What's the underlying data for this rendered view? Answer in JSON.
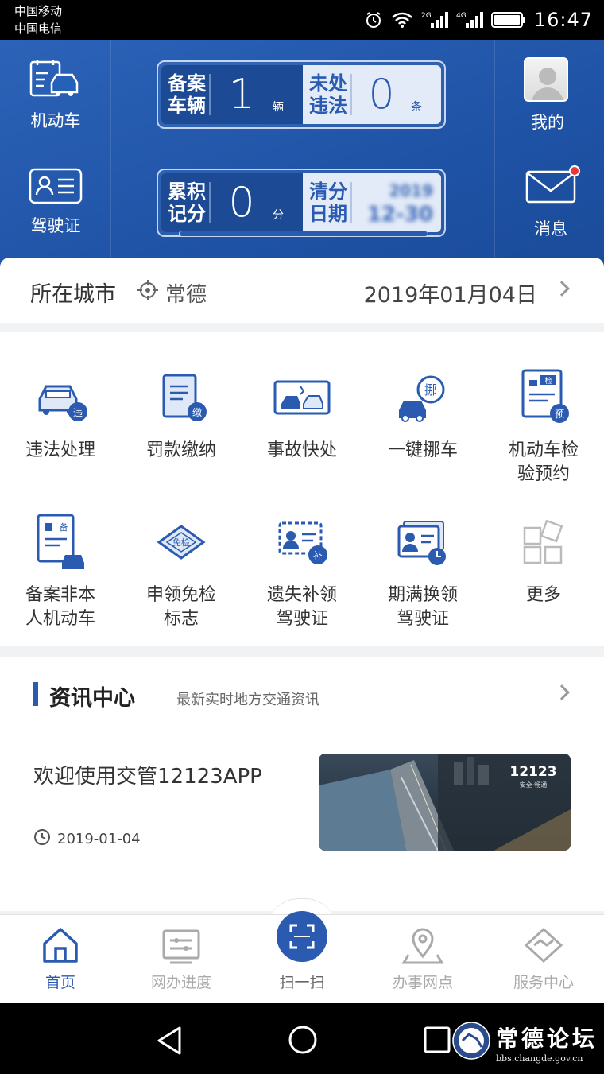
{
  "status_bar": {
    "carrier1": "中国移动",
    "carrier2": "中国电信",
    "network1": "2G",
    "network2": "4G",
    "time": "16:47"
  },
  "header": {
    "vehicle_label": "机动车",
    "license_label": "驾驶证",
    "mine_label": "我的",
    "message_label": "消息",
    "card1": {
      "left_label": "备案车辆",
      "left_value": "1",
      "left_unit": "辆",
      "right_label": "未处违法",
      "right_value": "0",
      "right_unit": "条"
    },
    "card2": {
      "left_label": "累积记分",
      "left_value": "0",
      "left_unit": "分",
      "right_label": "清分日期",
      "right_value_line1": "2019",
      "right_value_line2": "12-30"
    }
  },
  "city": {
    "label": "所在城市",
    "city_name": "常德",
    "date": "2019年01月04日"
  },
  "services": [
    {
      "label": "违法处理",
      "icon": "car-violation-icon",
      "badge": "违"
    },
    {
      "label": "罚款缴纳",
      "icon": "fine-payment-icon",
      "badge": "缴"
    },
    {
      "label": "事故快处",
      "icon": "accident-icon"
    },
    {
      "label": "一键挪车",
      "icon": "move-car-icon",
      "badge": "挪"
    },
    {
      "label": "机动车检验预约",
      "label_line1": "机动车检",
      "label_line2": "验预约",
      "icon": "inspection-booking-icon",
      "badge": "检",
      "badge2": "预"
    },
    {
      "label_line1": "备案非本",
      "label_line2": "人机动车",
      "icon": "register-vehicle-icon",
      "badge": "备"
    },
    {
      "label_line1": "申领免检",
      "label_line2": "标志",
      "icon": "exempt-mark-icon",
      "badge": "免检"
    },
    {
      "label_line1": "遗失补领",
      "label_line2": "驾驶证",
      "icon": "lost-license-icon",
      "badge": "补"
    },
    {
      "label_line1": "期满换领",
      "label_line2": "驾驶证",
      "icon": "renew-license-icon"
    },
    {
      "label": "更多",
      "icon": "more-grid-icon"
    }
  ],
  "news": {
    "title": "资讯中心",
    "subtitle": "最新实时地方交通资讯",
    "item_title": "欢迎使用交管12123APP",
    "item_date": "2019-01-04",
    "image_brand": "12123",
    "image_slogan": "安全·畅通"
  },
  "bottom_nav": [
    {
      "label": "首页",
      "icon": "home-icon",
      "active": true
    },
    {
      "label": "网办进度",
      "icon": "progress-icon"
    },
    {
      "label": "扫一扫",
      "icon": "scan-icon"
    },
    {
      "label": "办事网点",
      "icon": "location-pin-icon"
    },
    {
      "label": "服务中心",
      "icon": "service-center-icon"
    }
  ],
  "watermark": {
    "title": "常德论坛",
    "url": "bbs.changde.gov.cn"
  },
  "colors": {
    "brand_blue": "#2a5bb0",
    "header_blue": "#1f53a6",
    "badge_red": "#e63a3a"
  }
}
